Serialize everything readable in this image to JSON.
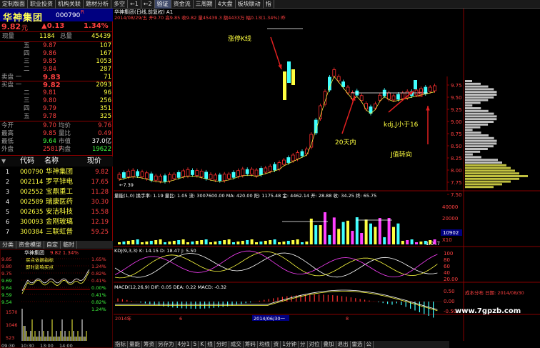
{
  "top_tabs": [
    "定制版面",
    "职业投资",
    "机构关联",
    "题材分析",
    "多空",
    "←1",
    "←2",
    "验证",
    "资金流",
    "三周期",
    "4大盘",
    "板块联动",
    "指"
  ],
  "stock": {
    "name": "华神集团",
    "code": "000790",
    "flag": "R",
    "price": "9.82",
    "unit": "元",
    "change": "▲0.13",
    "pct": "1.34%"
  },
  "volume_row": {
    "l1": "现量",
    "v1": "1184",
    "l2": "总量",
    "v2": "45439"
  },
  "asks": [
    {
      "label": "五",
      "price": "9.87",
      "vol": "107"
    },
    {
      "label": "四",
      "price": "9.86",
      "vol": "167"
    },
    {
      "label": "三",
      "price": "9.85",
      "vol": "1053"
    },
    {
      "label": "二",
      "price": "9.84",
      "vol": "287"
    },
    {
      "label": "卖盘 一",
      "price": "9.83",
      "vol": "71"
    }
  ],
  "bids": [
    {
      "label": "买盘 一",
      "price": "9.82",
      "vol": "2093"
    },
    {
      "label": "二",
      "price": "9.81",
      "vol": "96"
    },
    {
      "label": "三",
      "price": "9.80",
      "vol": "256"
    },
    {
      "label": "四",
      "price": "9.79",
      "vol": "351"
    },
    {
      "label": "五",
      "price": "9.78",
      "vol": "325"
    }
  ],
  "stats": [
    {
      "l1": "今开",
      "v1": "9.70",
      "l2": "均价",
      "v2": "9.76"
    },
    {
      "l1": "最高",
      "v1": "9.85",
      "l2": "量比",
      "v2": "0.49"
    },
    {
      "l1": "最低",
      "v1": "9.64",
      "l2": "市值",
      "v2": "37.0亿"
    },
    {
      "l1": "外盘",
      "v1": "25817",
      "l2": "内盘",
      "v2": "19622"
    }
  ],
  "list_header": {
    "code": "代码",
    "name": "名称",
    "price": "现价"
  },
  "list": [
    {
      "idx": "1",
      "code": "000790",
      "name": "华神集团",
      "price": "9.82"
    },
    {
      "idx": "2",
      "code": "002114",
      "name": "罗平锌电",
      "price": "17.65"
    },
    {
      "idx": "3",
      "code": "002552",
      "name": "宝鼎重工",
      "price": "11.28"
    },
    {
      "idx": "4",
      "code": "002589",
      "name": "瑞康医药",
      "price": "30.30"
    },
    {
      "idx": "5",
      "code": "002635",
      "name": "安洁科技",
      "price": "15.58"
    },
    {
      "idx": "6",
      "code": "300093",
      "name": "金刚玻璃",
      "price": "12.19"
    },
    {
      "idx": "7",
      "code": "300384",
      "name": "三联虹普",
      "price": "59.25"
    }
  ],
  "left_tabs": [
    "分类",
    "资金模型",
    "自定",
    "临时"
  ],
  "mini": {
    "title": "华神集团",
    "price": "9.82",
    "pct": "1.34%",
    "note1": "买点依据指标",
    "note2": "即时影响买点",
    "ylabels_left": [
      "9.85",
      "9.80",
      "9.75",
      "9.69",
      "9.64",
      "9.59",
      "9.54"
    ],
    "ylabels_right": [
      "1.65%",
      "1.24%",
      "0.82%",
      "0.41%",
      "0.00%",
      "0.41%",
      "0.82%",
      "1.24%"
    ],
    "vol_labels": [
      "1570",
      "1046",
      "523"
    ],
    "time_labels": [
      "09:30",
      "10:30",
      "13:00",
      "14:00"
    ]
  },
  "chart": {
    "title": "华神集团(日线,前复权) A1",
    "info": "2014/08/29/五 开9.70 高9.85 收9.82 量45439.3 额4433万 幅0.13(1.34%) 昨",
    "annotation_top": "涨停K线",
    "annotation_20": "20天内",
    "annotation_kdj": "kdj,J小于16",
    "annotation_j": "J值转向",
    "low_label": "←7.39",
    "price_axis": [
      "9.75",
      "9.50",
      "9.25",
      "9.00",
      "8.75",
      "8.50",
      "8.25",
      "8.00",
      "7.75",
      "7.50"
    ],
    "vol_title": "量能(1,0) 换手率: 1.19  量比: 1.05  流: 3007600.00  MA: 420.00  阳: 1175.48  金: 4462.14  开: 28.88  收: 34.25  终: 65.75",
    "vol_axis": [
      "40000",
      "20000",
      "10902",
      "X10"
    ],
    "vol_side": "1.047",
    "kdj_title": "KDJ(9,3,3)  K: 14.15  D: 18.47  J: 5.50",
    "kdj_axis": [
      "100",
      "80",
      "60",
      "40",
      "20.00"
    ],
    "macd_title": "MACD(12,26,9)  DIF: 0.05  DEA: 0.22  MACD: -0.32",
    "macd_axis": [
      "0.50",
      "0.00",
      "-0.50"
    ],
    "date_labels": [
      "2014年",
      "6",
      "2014/06/30一",
      "8"
    ],
    "cost_label": "成本分布 日期: 2014/08/30",
    "watermark": "www.7gpzb.com"
  },
  "bottom_tabs": [
    "指标",
    "量能",
    "筹资",
    "另存为",
    "4分1",
    "5",
    "K",
    "线",
    "分时",
    "成交",
    "筹码",
    "均线",
    "资",
    "1分钟",
    "分",
    "对位",
    "叠加",
    "退出",
    "雷选",
    "公"
  ],
  "chart_data": {
    "type": "bar",
    "title": "华神集团(日线,前复权) A1",
    "categories": [
      "2014年",
      "6",
      "2014/06/30",
      "8"
    ],
    "values": [
      9.7,
      9.85,
      9.64,
      9.82
    ],
    "ylim": [
      7.39,
      9.85
    ]
  }
}
